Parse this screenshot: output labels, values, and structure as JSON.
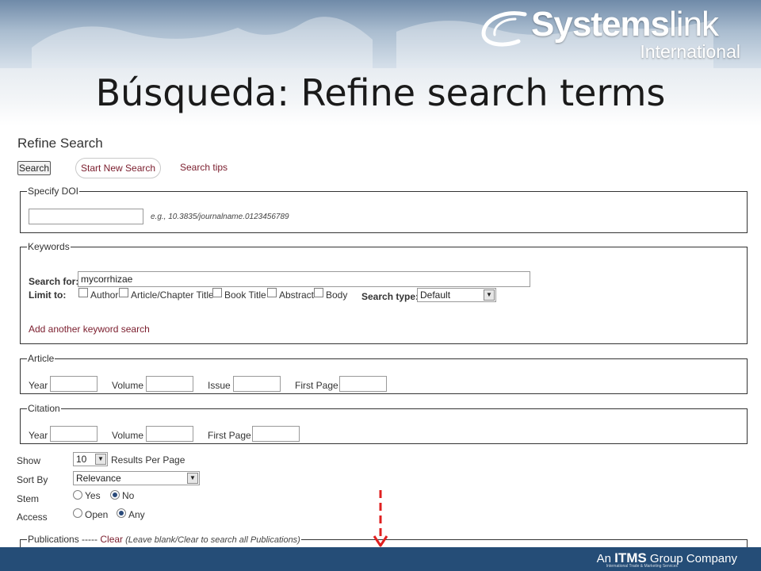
{
  "slide": {
    "title": "Búsqueda: Refine search terms",
    "logo": {
      "brand_bold": "Systems",
      "brand_light": "link",
      "sub": "International"
    },
    "footer": {
      "prefix": "An ",
      "brand": "ITMS",
      "middle": " Group ",
      "suffix": "Company",
      "tagline": "International Trade & Marketing Services"
    }
  },
  "page": {
    "title": "Refine Search",
    "search_button": "Search",
    "new_search_button": "Start New Search",
    "tips_link": "Search tips",
    "doi": {
      "legend": "Specify DOI",
      "value": "",
      "hint": "e.g., 10.3835/journalname.0123456789"
    },
    "keywords": {
      "legend": "Keywords",
      "search_for_label": "Search for:",
      "search_for_value": "mycorrhizae",
      "limit_to_label": "Limit to:",
      "limits": [
        "Author",
        "Article/Chapter Title",
        "Book Title",
        "Abstract",
        "Body"
      ],
      "search_type_label": "Search type:",
      "search_type_value": "Default",
      "add_link": "Add another keyword search"
    },
    "article": {
      "legend": "Article",
      "year": "Year",
      "volume": "Volume",
      "issue": "Issue",
      "first_page": "First Page"
    },
    "citation": {
      "legend": "Citation",
      "year": "Year",
      "volume": "Volume",
      "first_page": "First Page"
    },
    "options": {
      "show_label": "Show",
      "show_value": "10",
      "show_suffix": "Results Per Page",
      "sort_label": "Sort By",
      "sort_value": "Relevance",
      "stem_label": "Stem",
      "stem_yes": "Yes",
      "stem_no": "No",
      "stem_selected": "No",
      "access_label": "Access",
      "access_open": "Open",
      "access_any": "Any",
      "access_selected": "Any"
    },
    "publications": {
      "legend": "Publications",
      "sep": " ----- ",
      "clear_link": "Clear",
      "note": " (Leave blank/Clear to search all Publications)"
    }
  },
  "colors": {
    "accent_link": "#7a1c2c",
    "footer_bg": "#254d77",
    "arrow": "#e02020"
  }
}
